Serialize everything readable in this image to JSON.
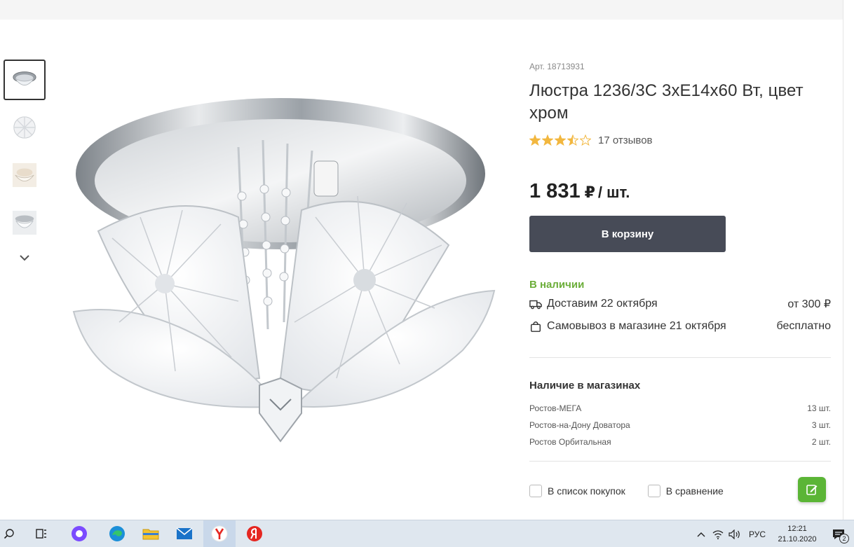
{
  "product": {
    "sku": "Арт. 18713931",
    "title": "Люстра 1236/3С 3хЕ14х60 Вт, цвет хром",
    "rating": 3.5,
    "rating_max": 5,
    "reviews": "17 отзывов",
    "price": "1 831",
    "currency": "₽",
    "unit": "/ шт.",
    "cart_label": "В корзину",
    "availability": "В наличии",
    "delivery_label": "Доставим 22 октября",
    "delivery_price": "от 300 ₽",
    "pickup_label": "Самовывоз в магазине 21 октября",
    "pickup_price": "бесплатно"
  },
  "stores": {
    "title": "Наличие в магазинах",
    "items": [
      {
        "name": "Ростов-МЕГА",
        "qty": "13 шт."
      },
      {
        "name": "Ростов-на-Дону Доватора",
        "qty": "3 шт."
      },
      {
        "name": "Ростов Орбитальная",
        "qty": "2 шт."
      }
    ]
  },
  "actions": {
    "shopping_list": "В список покупок",
    "compare": "В сравнение"
  },
  "colors": {
    "accent_green": "#6cae3a",
    "button_dark": "#474b57",
    "star": "#f2b73f"
  },
  "taskbar": {
    "language": "РУС",
    "time": "12:21",
    "date": "21.10.2020",
    "notification_count": "2"
  }
}
